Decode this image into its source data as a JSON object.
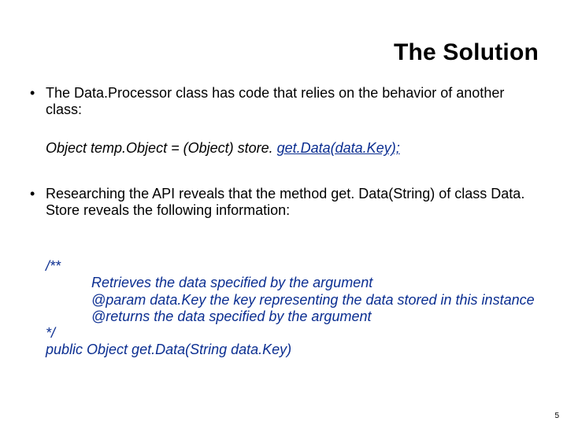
{
  "title": "The Solution",
  "bullets": {
    "b1": "The Data.Processor class has code that relies on the behavior of another class:",
    "code1_pre": "Object temp.Object = (Object) store. ",
    "code1_link": "get.Data(data.Key);",
    "b2": "Researching the API reveals that the method get. Data(String) of class Data. Store reveals the following information:"
  },
  "javadoc": {
    "open": "/**",
    "l1": "Retrieves the data specified by the argument",
    "l2": "@param data.Key the key representing the data stored in this instance",
    "l3": "@returns the data specified by the argument",
    "close": "*/",
    "sig": " public Object get.Data(String data.Key)"
  },
  "page_number": "5"
}
